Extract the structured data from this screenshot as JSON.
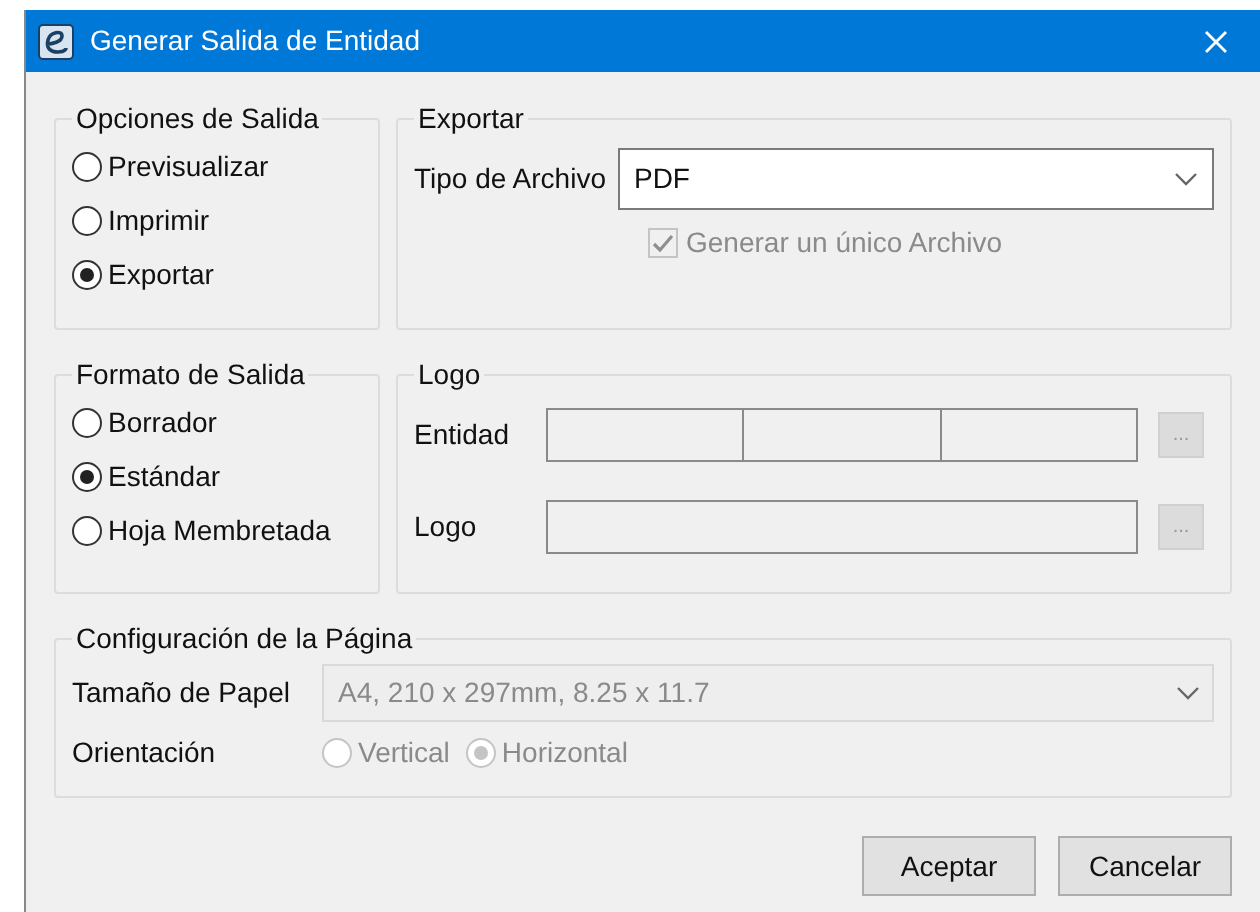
{
  "window": {
    "title": "Generar Salida de Entidad"
  },
  "output_options": {
    "legend": "Opciones de Salida",
    "options": [
      {
        "label": "Previsualizar",
        "selected": false
      },
      {
        "label": "Imprimir",
        "selected": false
      },
      {
        "label": "Exportar",
        "selected": true
      }
    ]
  },
  "export": {
    "legend": "Exportar",
    "file_type_label": "Tipo de Archivo",
    "file_type_value": "PDF",
    "single_file": {
      "label": "Generar un único Archivo",
      "checked": true,
      "disabled": true
    }
  },
  "output_format": {
    "legend": "Formato de Salida",
    "options": [
      {
        "label": "Borrador",
        "selected": false
      },
      {
        "label": "Estándar",
        "selected": true
      },
      {
        "label": "Hoja Membretada",
        "selected": false
      }
    ]
  },
  "logo": {
    "legend": "Logo",
    "entity_label": "Entidad",
    "entity_browse": "...",
    "logo_label": "Logo",
    "logo_browse": "..."
  },
  "page_setup": {
    "legend": "Configuración de la Página",
    "paper_size_label": "Tamaño de Papel",
    "paper_size_value": "A4, 210 x 297mm, 8.25 x 11.7",
    "orientation_label": "Orientación",
    "orientations": [
      {
        "label": "Vertical",
        "selected": false
      },
      {
        "label": "Horizontal",
        "selected": true
      }
    ],
    "disabled": true
  },
  "buttons": [
    "Aceptar",
    "Cancelar"
  ]
}
